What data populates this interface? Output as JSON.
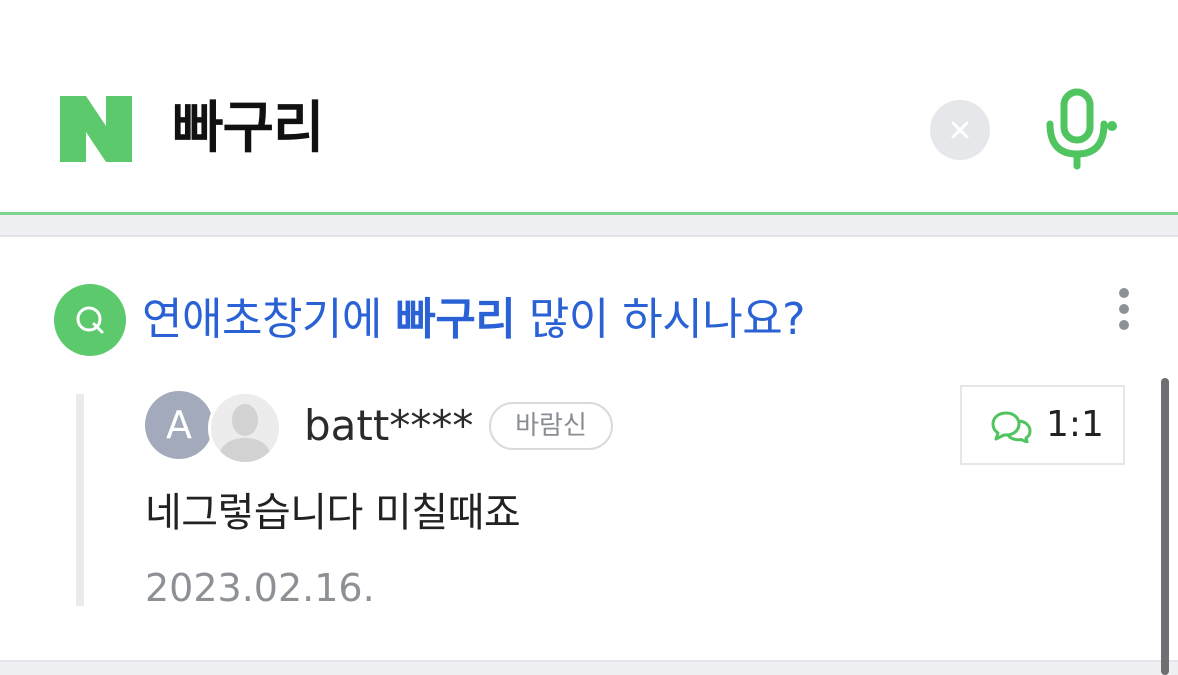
{
  "search": {
    "logo_letter": "N",
    "query": "빠구리",
    "clear_icon": "close-icon",
    "mic_icon": "microphone-icon"
  },
  "question": {
    "badge_letter": "Q",
    "title_before": "연애초창기에 ",
    "title_highlight": "빠구리",
    "title_after": " 많이 하시나요?",
    "more_icon": "more-vertical-icon"
  },
  "answer": {
    "avatar_letter": "A",
    "username": "batt****",
    "grade": "바람신",
    "chat_label": "1:1",
    "chat_icon": "chat-bubbles-icon",
    "text": "네그렇습니다 미칠때죠",
    "date": "2023.02.16."
  },
  "colors": {
    "brand_green": "#5cc96c",
    "link_blue": "#2a62d6",
    "underline_green": "#7ed38f"
  }
}
